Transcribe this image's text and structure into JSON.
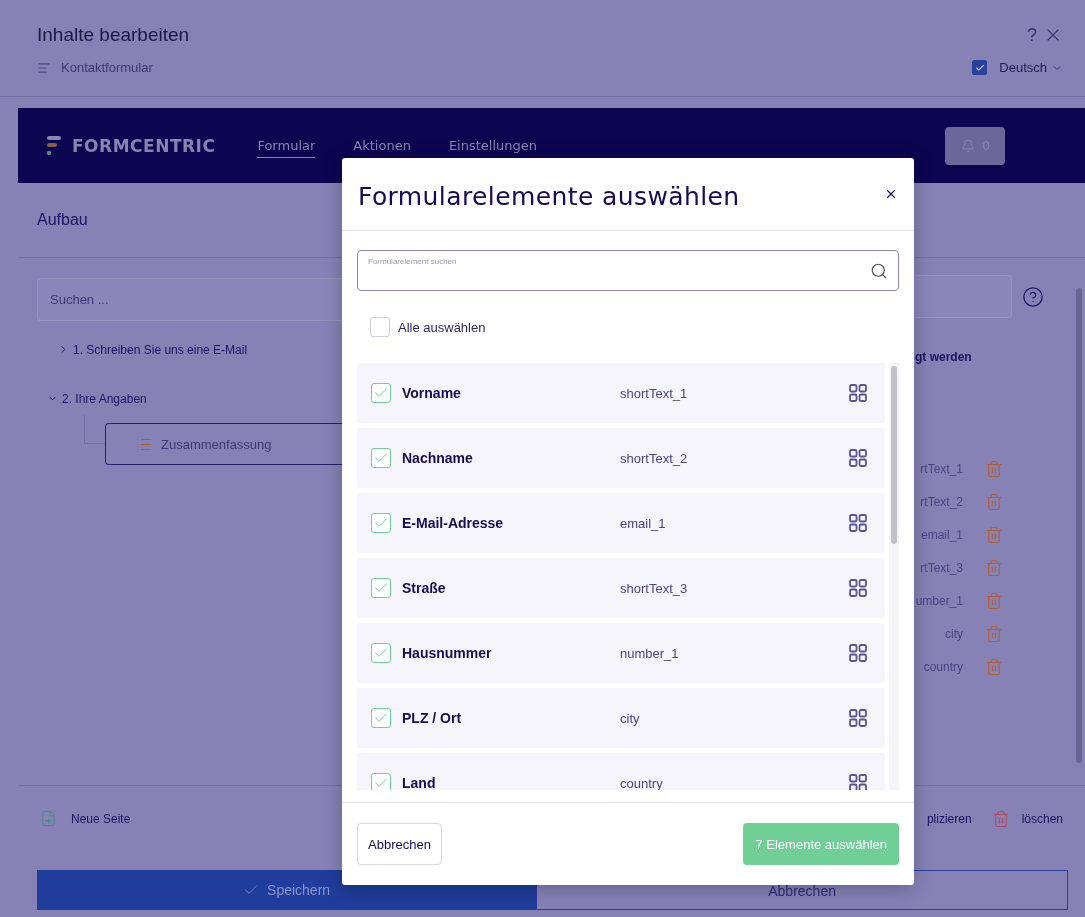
{
  "window": {
    "title": "Inhalte bearbeiten",
    "help": "?",
    "breadcrumb": "Kontaktformular",
    "language": {
      "label": "Deutsch",
      "checked": true
    }
  },
  "nav": {
    "brand": "FORMCENTRIC",
    "tabs": [
      {
        "label": "Formular",
        "selected": true
      },
      {
        "label": "Aktionen",
        "selected": false
      },
      {
        "label": "Einstellungen",
        "selected": false
      }
    ],
    "notifications": "0"
  },
  "section_title": "Aufbau",
  "tree": {
    "search_placeholder": "Suchen ...",
    "pages": [
      {
        "label": "1. Schreiben Sie uns eine E-Mail",
        "expanded": false
      },
      {
        "label": "2. Ihre Angaben",
        "expanded": true,
        "children": [
          {
            "label": "Zusammenfassung"
          }
        ]
      }
    ]
  },
  "right_panel": {
    "note": "gt werden",
    "fields": [
      "rtText_1",
      "rtText_2",
      "email_1",
      "rtText_3",
      "umber_1",
      "city",
      "country"
    ]
  },
  "bottom_bar": {
    "new_page": "Neue Seite",
    "duplicate": "plizieren",
    "delete": "löschen"
  },
  "actions": {
    "save": "Speichern",
    "cancel": "Abbrechen"
  },
  "dialog": {
    "title": "Formularelemente auswählen",
    "search": {
      "label": "Formularelement suchen"
    },
    "select_all": {
      "label": "Alle auswählen",
      "checked": false
    },
    "elements": [
      {
        "label": "Vorname",
        "id": "shortText_1",
        "checked": true
      },
      {
        "label": "Nachname",
        "id": "shortText_2",
        "checked": true
      },
      {
        "label": "E-Mail-Adresse",
        "id": "email_1",
        "checked": true
      },
      {
        "label": "Straße",
        "id": "shortText_3",
        "checked": true
      },
      {
        "label": "Hausnummer",
        "id": "number_1",
        "checked": true
      },
      {
        "label": "PLZ / Ort",
        "id": "city",
        "checked": true
      },
      {
        "label": "Land",
        "id": "country",
        "checked": true
      }
    ],
    "cancel": "Abbrechen",
    "confirm": "7 Elemente auswählen"
  }
}
